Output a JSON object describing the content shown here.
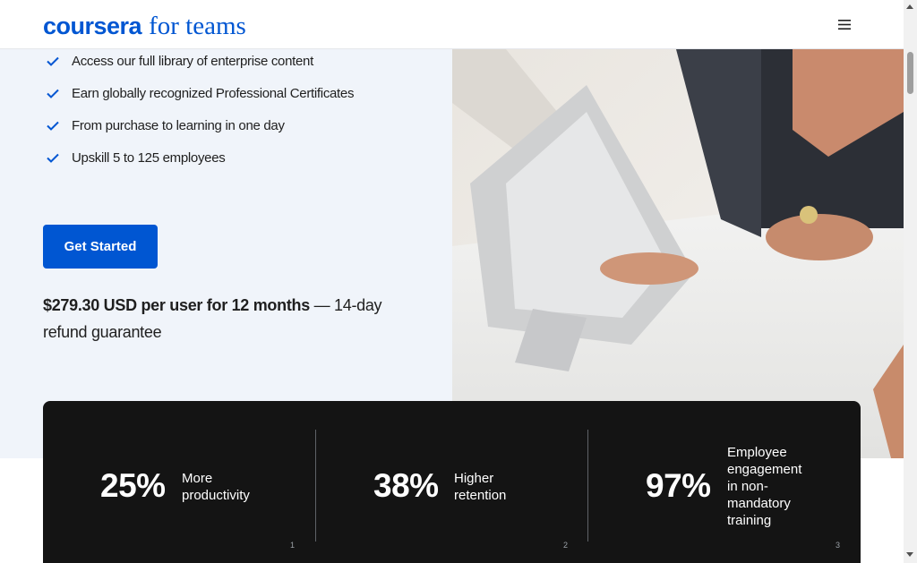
{
  "header": {
    "logo_brand": "coursera",
    "logo_suffix": "for teams",
    "menu_icon": "hamburger-menu-icon"
  },
  "hero": {
    "benefits": [
      "Access our full library of enterprise content",
      "Earn globally recognized Professional Certificates",
      "From purchase to learning in one day",
      "Upskill 5 to 125 employees"
    ],
    "check_icon": "check-icon",
    "cta_label": "Get Started",
    "price_strong": "$279.30 USD per user for 12 months",
    "price_rest": " — 14-day refund guarantee"
  },
  "stats": [
    {
      "value": "25%",
      "label": "More productivity",
      "footnote": "1"
    },
    {
      "value": "38%",
      "label": "Higher retention",
      "footnote": "2"
    },
    {
      "value": "97%",
      "label": "Employee engagement in non-mandatory training",
      "footnote": "3"
    }
  ],
  "colors": {
    "brand_blue": "#0056d2",
    "hero_background": "#f0f4fa",
    "stats_background": "#141414"
  }
}
